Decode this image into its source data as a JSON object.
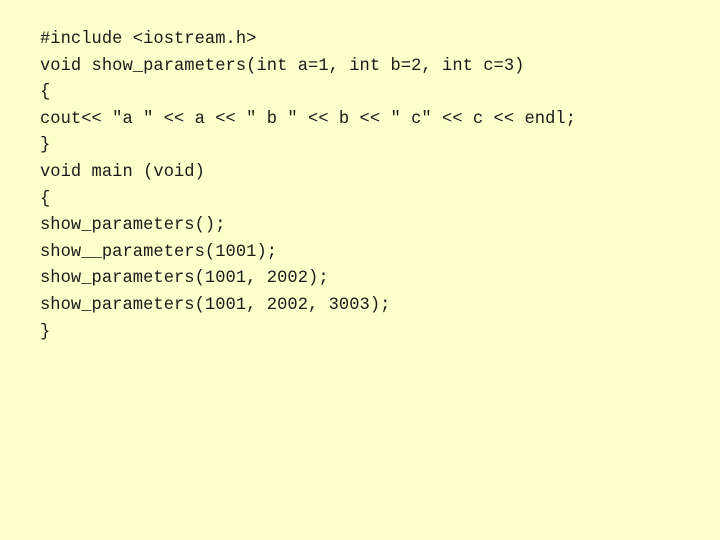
{
  "slide": {
    "background_color": "#ffffcc",
    "text_color": "#1a1a1a",
    "title": "",
    "language": "cpp",
    "code_lines": [
      "#include <iostream.h>",
      "void show_parameters(int a=1, int b=2, int c=3)",
      "{",
      "cout<< \"a \" << a << \" b \" << b << \" c\" << c << endl;",
      "}",
      "void main (void)",
      "{",
      "show_parameters();",
      "show__parameters(1001);",
      "show_parameters(1001, 2002);",
      "show_parameters(1001, 2002, 3003);",
      "}"
    ]
  }
}
